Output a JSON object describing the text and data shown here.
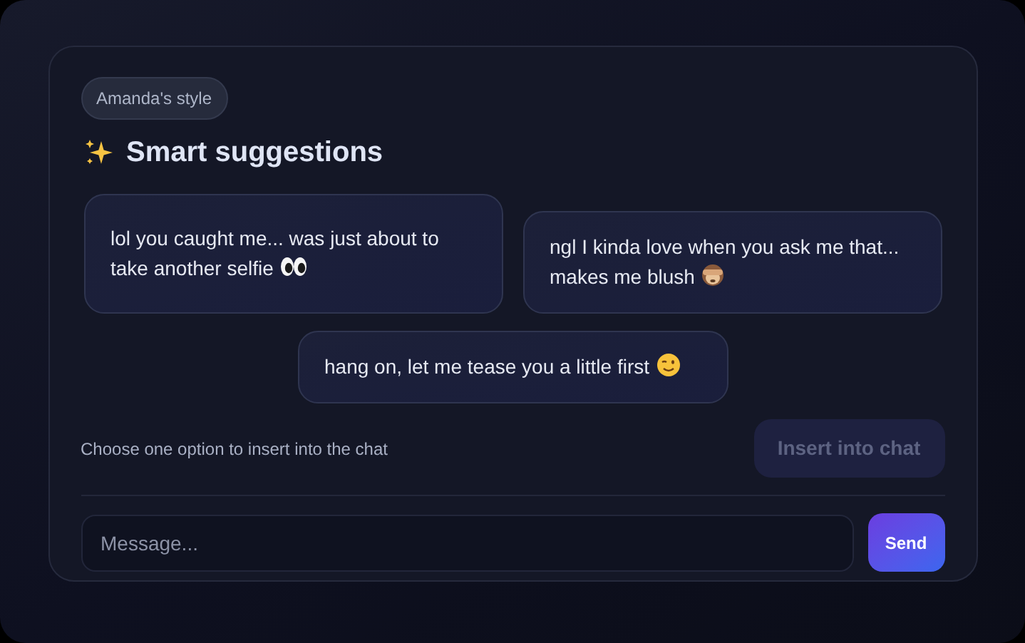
{
  "badge": "Amanda's style",
  "title": "Smart suggestions",
  "suggestions": [
    {
      "text": "lol you caught me... was just about to take another selfie",
      "kind": "eyes",
      "selected": false
    },
    {
      "text": "ngl I kinda love when you ask me that... makes me blush",
      "kind": "monkey",
      "selected": false
    },
    {
      "text": "hang on, let me tease you a little first",
      "kind": "wink",
      "selected": false
    }
  ],
  "hint": "Choose one option to insert into the chat",
  "insert_button": {
    "label": "Insert into chat",
    "disabled": true
  },
  "message": {
    "placeholder": "Message..."
  },
  "send_button": "Send"
}
